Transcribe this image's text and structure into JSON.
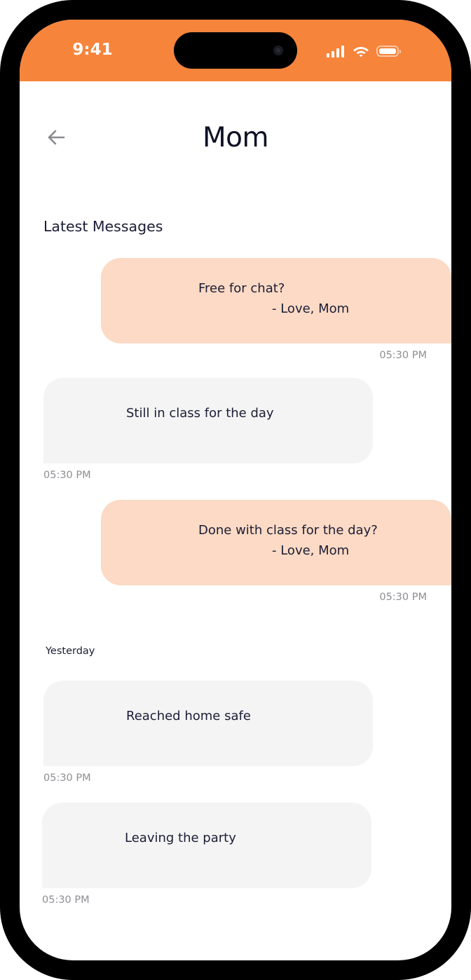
{
  "status_bar": {
    "time": "9:41",
    "background_color": "#F7843B",
    "icons": [
      "signal-icon",
      "wifi-icon",
      "battery-icon"
    ]
  },
  "header": {
    "back_icon": "arrow-left-icon",
    "title": "Mom"
  },
  "latest_section": {
    "title": "Latest Messages",
    "messages": [
      {
        "direction": "sent",
        "text": "Free for chat?",
        "signature": "- Love, Mom",
        "time": "05:30 PM"
      },
      {
        "direction": "received",
        "text": "Still in class for the day",
        "time": "05:30 PM"
      },
      {
        "direction": "sent",
        "text": "Done with class for the day?",
        "signature": "- Love, Mom",
        "time": "05:30 PM"
      }
    ]
  },
  "yesterday_section": {
    "label": "Yesterday",
    "messages": [
      {
        "direction": "received",
        "text": "Reached home safe",
        "time": "05:30 PM"
      },
      {
        "direction": "received",
        "text": "Leaving the party",
        "time": "05:30 PM"
      }
    ]
  },
  "colors": {
    "sent_bubble": "#FCDAC5",
    "received_bubble": "#F4F4F4",
    "text_primary": "#1B1D36",
    "timestamp": "#8E8E93"
  }
}
